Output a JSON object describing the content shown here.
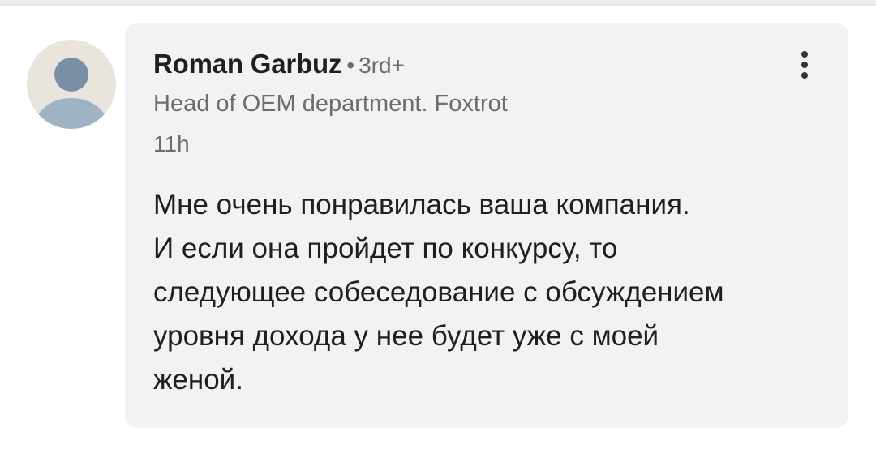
{
  "comment": {
    "author": {
      "name": "Roman Garbuz",
      "separator": "•",
      "degree": "3rd+",
      "headline": "Head of OEM department. Foxtrot"
    },
    "time": "11h",
    "body_lines": [
      "Мне очень понравилась ваша компания.",
      "И если она пройдет по конкурсу, то",
      "следующее собеседование с обсуждением",
      "уровня дохода у нее будет уже с моей",
      "женой."
    ],
    "avatar_icon": "default-person-avatar",
    "more_icon": "vertical-ellipsis-icon"
  }
}
